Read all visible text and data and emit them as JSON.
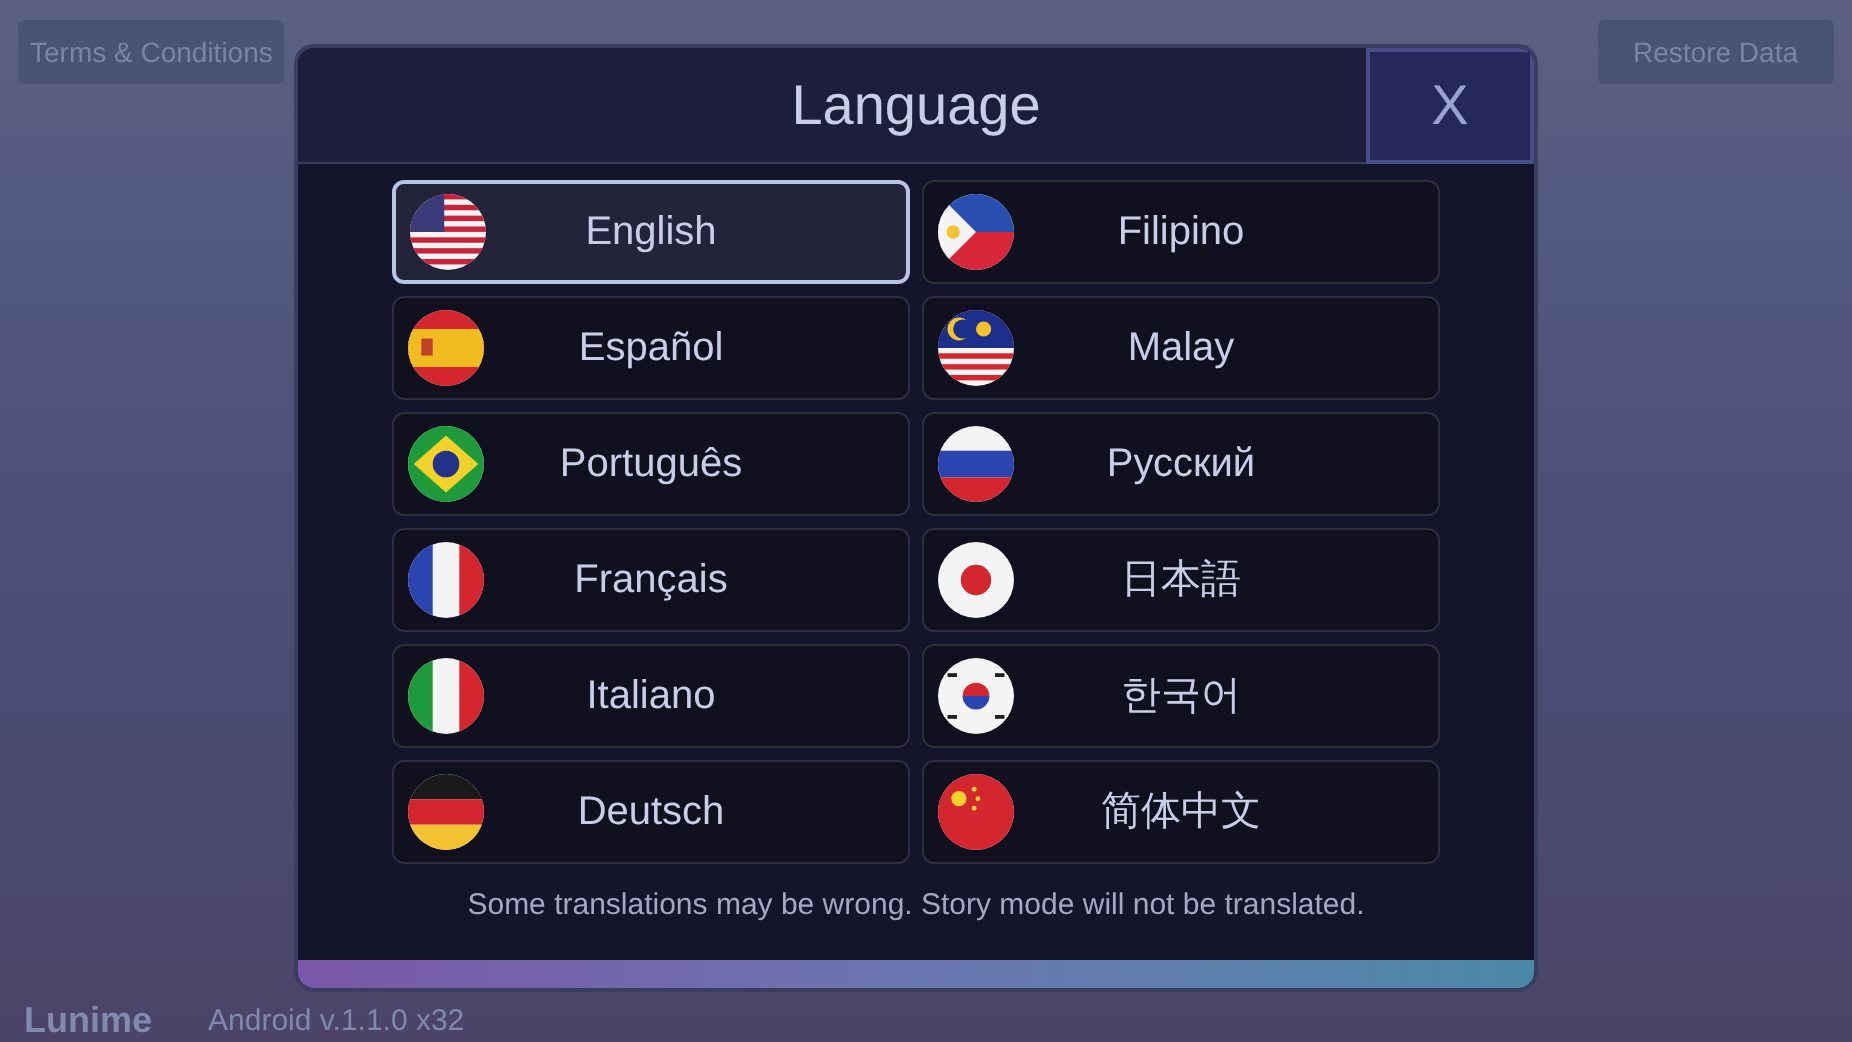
{
  "top_buttons": [
    "Terms & Conditions",
    "Restore Data"
  ],
  "dialog": {
    "title": "Language",
    "close": "X",
    "languages": [
      {
        "label": "English",
        "kind": "us",
        "selected": true
      },
      {
        "label": "Filipino",
        "kind": "ph",
        "selected": false
      },
      {
        "label": "Español",
        "kind": "es",
        "selected": false
      },
      {
        "label": "Malay",
        "kind": "my",
        "selected": false
      },
      {
        "label": "Português",
        "kind": "br",
        "selected": false
      },
      {
        "label": "Русский",
        "kind": "ru",
        "selected": false
      },
      {
        "label": "Français",
        "kind": "fr",
        "selected": false
      },
      {
        "label": "日本語",
        "kind": "jp",
        "selected": false
      },
      {
        "label": "Italiano",
        "kind": "it",
        "selected": false
      },
      {
        "label": "한국어",
        "kind": "kr",
        "selected": false
      },
      {
        "label": "Deutsch",
        "kind": "de",
        "selected": false
      },
      {
        "label": "简体中文",
        "kind": "cn",
        "selected": false
      }
    ],
    "note": "Some translations may be wrong. Story mode will not be translated."
  },
  "footer": {
    "logo": "Lunime",
    "version": "Android v.1.1.0 x32"
  }
}
